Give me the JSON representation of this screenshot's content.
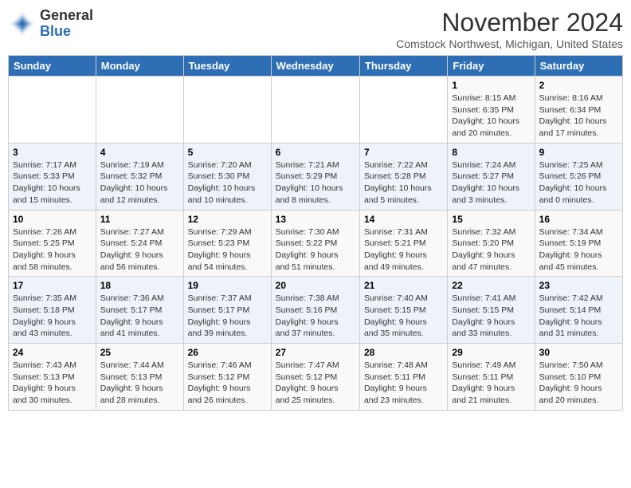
{
  "header": {
    "logo_line1": "General",
    "logo_line2": "Blue",
    "month": "November 2024",
    "location": "Comstock Northwest, Michigan, United States"
  },
  "weekdays": [
    "Sunday",
    "Monday",
    "Tuesday",
    "Wednesday",
    "Thursday",
    "Friday",
    "Saturday"
  ],
  "weeks": [
    [
      {
        "day": "",
        "info": ""
      },
      {
        "day": "",
        "info": ""
      },
      {
        "day": "",
        "info": ""
      },
      {
        "day": "",
        "info": ""
      },
      {
        "day": "",
        "info": ""
      },
      {
        "day": "1",
        "info": "Sunrise: 8:15 AM\nSunset: 6:35 PM\nDaylight: 10 hours\nand 20 minutes."
      },
      {
        "day": "2",
        "info": "Sunrise: 8:16 AM\nSunset: 6:34 PM\nDaylight: 10 hours\nand 17 minutes."
      }
    ],
    [
      {
        "day": "3",
        "info": "Sunrise: 7:17 AM\nSunset: 5:33 PM\nDaylight: 10 hours\nand 15 minutes."
      },
      {
        "day": "4",
        "info": "Sunrise: 7:19 AM\nSunset: 5:32 PM\nDaylight: 10 hours\nand 12 minutes."
      },
      {
        "day": "5",
        "info": "Sunrise: 7:20 AM\nSunset: 5:30 PM\nDaylight: 10 hours\nand 10 minutes."
      },
      {
        "day": "6",
        "info": "Sunrise: 7:21 AM\nSunset: 5:29 PM\nDaylight: 10 hours\nand 8 minutes."
      },
      {
        "day": "7",
        "info": "Sunrise: 7:22 AM\nSunset: 5:28 PM\nDaylight: 10 hours\nand 5 minutes."
      },
      {
        "day": "8",
        "info": "Sunrise: 7:24 AM\nSunset: 5:27 PM\nDaylight: 10 hours\nand 3 minutes."
      },
      {
        "day": "9",
        "info": "Sunrise: 7:25 AM\nSunset: 5:26 PM\nDaylight: 10 hours\nand 0 minutes."
      }
    ],
    [
      {
        "day": "10",
        "info": "Sunrise: 7:26 AM\nSunset: 5:25 PM\nDaylight: 9 hours\nand 58 minutes."
      },
      {
        "day": "11",
        "info": "Sunrise: 7:27 AM\nSunset: 5:24 PM\nDaylight: 9 hours\nand 56 minutes."
      },
      {
        "day": "12",
        "info": "Sunrise: 7:29 AM\nSunset: 5:23 PM\nDaylight: 9 hours\nand 54 minutes."
      },
      {
        "day": "13",
        "info": "Sunrise: 7:30 AM\nSunset: 5:22 PM\nDaylight: 9 hours\nand 51 minutes."
      },
      {
        "day": "14",
        "info": "Sunrise: 7:31 AM\nSunset: 5:21 PM\nDaylight: 9 hours\nand 49 minutes."
      },
      {
        "day": "15",
        "info": "Sunrise: 7:32 AM\nSunset: 5:20 PM\nDaylight: 9 hours\nand 47 minutes."
      },
      {
        "day": "16",
        "info": "Sunrise: 7:34 AM\nSunset: 5:19 PM\nDaylight: 9 hours\nand 45 minutes."
      }
    ],
    [
      {
        "day": "17",
        "info": "Sunrise: 7:35 AM\nSunset: 5:18 PM\nDaylight: 9 hours\nand 43 minutes."
      },
      {
        "day": "18",
        "info": "Sunrise: 7:36 AM\nSunset: 5:17 PM\nDaylight: 9 hours\nand 41 minutes."
      },
      {
        "day": "19",
        "info": "Sunrise: 7:37 AM\nSunset: 5:17 PM\nDaylight: 9 hours\nand 39 minutes."
      },
      {
        "day": "20",
        "info": "Sunrise: 7:38 AM\nSunset: 5:16 PM\nDaylight: 9 hours\nand 37 minutes."
      },
      {
        "day": "21",
        "info": "Sunrise: 7:40 AM\nSunset: 5:15 PM\nDaylight: 9 hours\nand 35 minutes."
      },
      {
        "day": "22",
        "info": "Sunrise: 7:41 AM\nSunset: 5:15 PM\nDaylight: 9 hours\nand 33 minutes."
      },
      {
        "day": "23",
        "info": "Sunrise: 7:42 AM\nSunset: 5:14 PM\nDaylight: 9 hours\nand 31 minutes."
      }
    ],
    [
      {
        "day": "24",
        "info": "Sunrise: 7:43 AM\nSunset: 5:13 PM\nDaylight: 9 hours\nand 30 minutes."
      },
      {
        "day": "25",
        "info": "Sunrise: 7:44 AM\nSunset: 5:13 PM\nDaylight: 9 hours\nand 28 minutes."
      },
      {
        "day": "26",
        "info": "Sunrise: 7:46 AM\nSunset: 5:12 PM\nDaylight: 9 hours\nand 26 minutes."
      },
      {
        "day": "27",
        "info": "Sunrise: 7:47 AM\nSunset: 5:12 PM\nDaylight: 9 hours\nand 25 minutes."
      },
      {
        "day": "28",
        "info": "Sunrise: 7:48 AM\nSunset: 5:11 PM\nDaylight: 9 hours\nand 23 minutes."
      },
      {
        "day": "29",
        "info": "Sunrise: 7:49 AM\nSunset: 5:11 PM\nDaylight: 9 hours\nand 21 minutes."
      },
      {
        "day": "30",
        "info": "Sunrise: 7:50 AM\nSunset: 5:10 PM\nDaylight: 9 hours\nand 20 minutes."
      }
    ]
  ]
}
